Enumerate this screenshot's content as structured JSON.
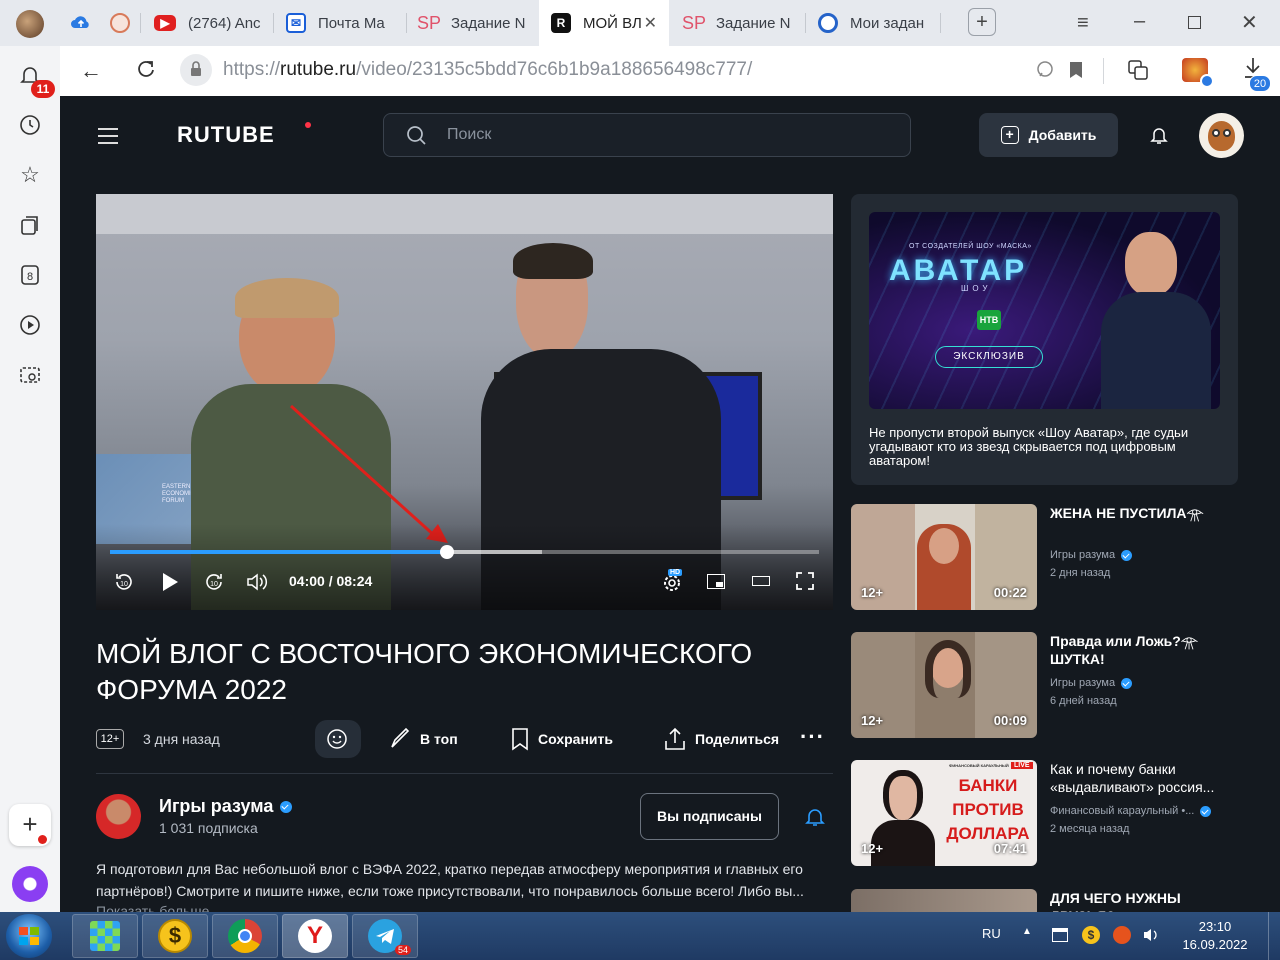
{
  "browser": {
    "tabs": [
      {
        "label": "(2764) Anc",
        "icon": "youtube-icon"
      },
      {
        "label": "Почта Ma",
        "icon": "mail-icon"
      },
      {
        "label": "Задание N",
        "icon": "sp-icon"
      },
      {
        "label": "МОЙ ВЛ",
        "icon": "rutube-icon"
      },
      {
        "label": "Задание N",
        "icon": "sp-icon"
      },
      {
        "label": "Мои задан",
        "icon": "target-icon"
      }
    ],
    "url_prefix": "https://",
    "url_host": "rutube.ru",
    "url_path": "/video/23135c5bdd76c6b1b9a188656498c777/",
    "notifications_count": "11",
    "downloads_count": "20"
  },
  "header": {
    "logo": "RUTUBE",
    "search_placeholder": "Поиск",
    "add_label": "Добавить"
  },
  "player": {
    "time_current": "04:00",
    "time_total": "08:24",
    "progress": 0.475,
    "buffered": 0.61,
    "hd_badge": "HD",
    "screen_text": [
      "EASTERN",
      "ECONOMIC",
      "FORUM"
    ]
  },
  "video": {
    "title": "МОЙ ВЛОГ С ВОСТОЧНОГО ЭКОНОМИЧЕСКОГО ФОРУМА 2022",
    "age": "12+",
    "date": "3 дня назад",
    "top_label": "В топ",
    "save_label": "Сохранить",
    "share_label": "Поделиться"
  },
  "channel": {
    "name": "Игры разума",
    "subs": "1 031 подписка",
    "subscribed_label": "Вы подписаны",
    "description": "Я подготовил для Вас небольшой влог с ВЭФА 2022, кратко передав атмосферу мероприятия и главных его партнёров!) Смотрите и пишите ниже, если тоже присутствовали, что понравилось больше всего! Либо вы...",
    "show_more": "Показать больше"
  },
  "promo": {
    "brand_top": "ОТ СОЗДАТЕЛЕЙ ШОУ «МАСКА»",
    "brand": "АВАТАР",
    "brand_sub": "ШОУ",
    "exclusive": "ЭКСКЛЮЗИВ",
    "text": "Не пропусти второй выпуск «Шоу Аватар», где судьи угадывают кто из звезд скрывается под цифровым аватаром!"
  },
  "suggestions": [
    {
      "title": "ЖЕНА НЕ ПУСТИЛА𓁿",
      "channel": "Игры разума",
      "date": "2 дня назад",
      "age": "12+",
      "duration": "00:22"
    },
    {
      "title": "Правда или Ложь?𓁿 ШУТКА!",
      "channel": "Игры разума",
      "date": "6 дней назад",
      "age": "12+",
      "duration": "00:09"
    },
    {
      "title": "Как и почему банки «выдавливают» россия...",
      "channel": "Финансовый караульный •...",
      "date": "2 месяца назад",
      "age": "12+",
      "duration": "07:41",
      "thumb_text": [
        "БАНКИ",
        "ПРОТИВ",
        "ДОЛЛАРА"
      ],
      "live": "LIVE",
      "thumb_small": "ФИНАНСОВЫЙ КАРАУЛЬНЫЙ"
    },
    {
      "title": "ДЛЯ ЧЕГО НУЖНЫ ДРУЗЬЯ?𓁿"
    }
  ],
  "taskbar": {
    "lang": "RU",
    "time": "23:10",
    "date": "16.09.2022",
    "telegram_badge": "54"
  },
  "colors": {
    "accent": "#2b9dff",
    "page_bg": "#14191f",
    "panel_bg": "#232a33",
    "logo_dot": "#ff3347",
    "badge_red": "#e0201b"
  }
}
